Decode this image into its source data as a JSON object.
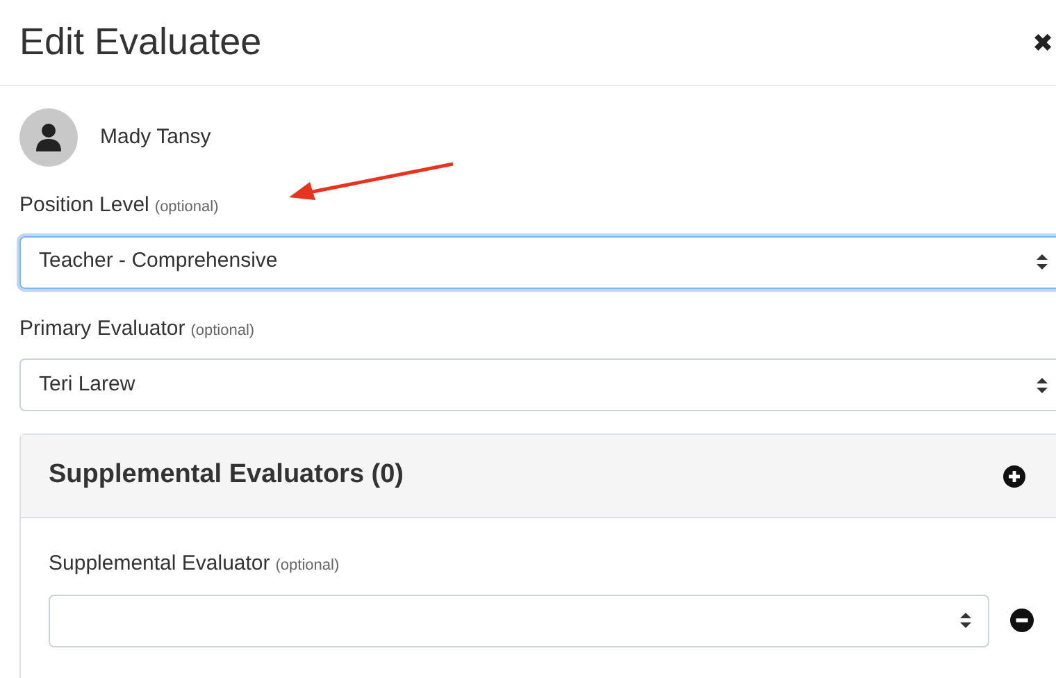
{
  "dialog": {
    "title": "Edit Evaluatee",
    "close_symbol": "✖"
  },
  "evaluatee": {
    "name": "Mady Tansy"
  },
  "fields": [
    {
      "label": "Position Level",
      "hint": "(optional)",
      "value": "Teacher - Comprehensive",
      "focused": true
    },
    {
      "label": "Primary Evaluator",
      "hint": "(optional)",
      "value": "Teri Larew",
      "focused": false
    }
  ],
  "supplemental": {
    "title": "Supplemental Evaluators (0)",
    "rows": [
      {
        "label": "Supplemental Evaluator",
        "hint": "(optional)",
        "value": ""
      }
    ]
  }
}
